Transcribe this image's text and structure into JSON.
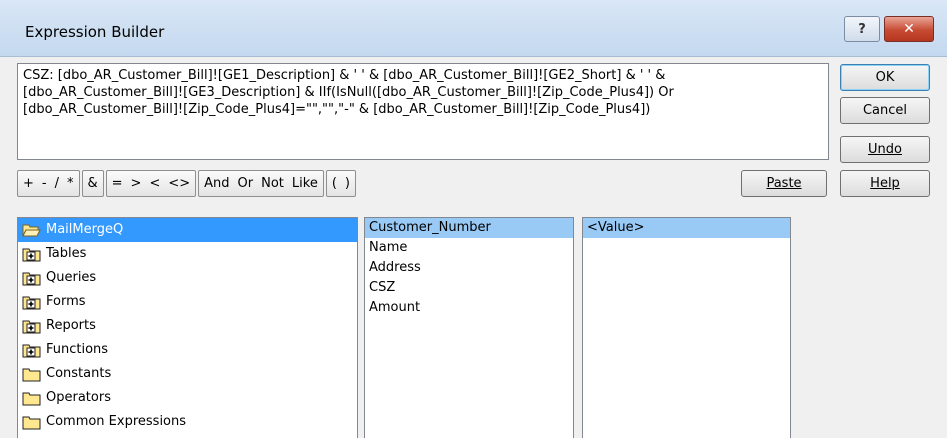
{
  "window": {
    "title": "Expression Builder",
    "help_btn": "?",
    "close_btn": "✕"
  },
  "expression": {
    "text": "CSZ: [dbo_AR_Customer_Bill]![GE1_Description] & ' ' & [dbo_AR_Customer_Bill]![GE2_Short] & ' ' & [dbo_AR_Customer_Bill]![GE3_Description] & IIf(IsNull([dbo_AR_Customer_Bill]![Zip_Code_Plus4]) Or [dbo_AR_Customer_Bill]![Zip_Code_Plus4]=\"\",\"\",\"-\" & [dbo_AR_Customer_Bill]![Zip_Code_Plus4])"
  },
  "buttons": {
    "ok": "OK",
    "cancel": "Cancel",
    "undo": "Undo",
    "help": "Help",
    "paste": "Paste"
  },
  "operators": {
    "group1": [
      "+",
      "-",
      "/",
      "*"
    ],
    "group2": [
      "&"
    ],
    "group3": [
      "=",
      ">",
      "<",
      "<>"
    ],
    "group4": [
      "And",
      "Or",
      "Not",
      "Like"
    ],
    "group5": [
      "(",
      ")"
    ]
  },
  "folders": [
    {
      "label": "MailMergeQ",
      "icon": "open-folder-icon",
      "selected": true
    },
    {
      "label": "Tables",
      "icon": "folder-plus-icon"
    },
    {
      "label": "Queries",
      "icon": "folder-plus-icon"
    },
    {
      "label": "Forms",
      "icon": "folder-plus-icon"
    },
    {
      "label": "Reports",
      "icon": "folder-plus-icon"
    },
    {
      "label": "Functions",
      "icon": "folder-plus-icon"
    },
    {
      "label": "Constants",
      "icon": "folder-icon"
    },
    {
      "label": "Operators",
      "icon": "folder-icon"
    },
    {
      "label": "Common Expressions",
      "icon": "folder-icon"
    }
  ],
  "fields": [
    "Customer_Number",
    "Name",
    "Address",
    "CSZ",
    "Amount"
  ],
  "values": [
    "<Value>"
  ],
  "colors": {
    "folder_fill": "#ffe78f",
    "selection_primary": "#3399ff",
    "selection_secondary": "#99c9f5"
  }
}
